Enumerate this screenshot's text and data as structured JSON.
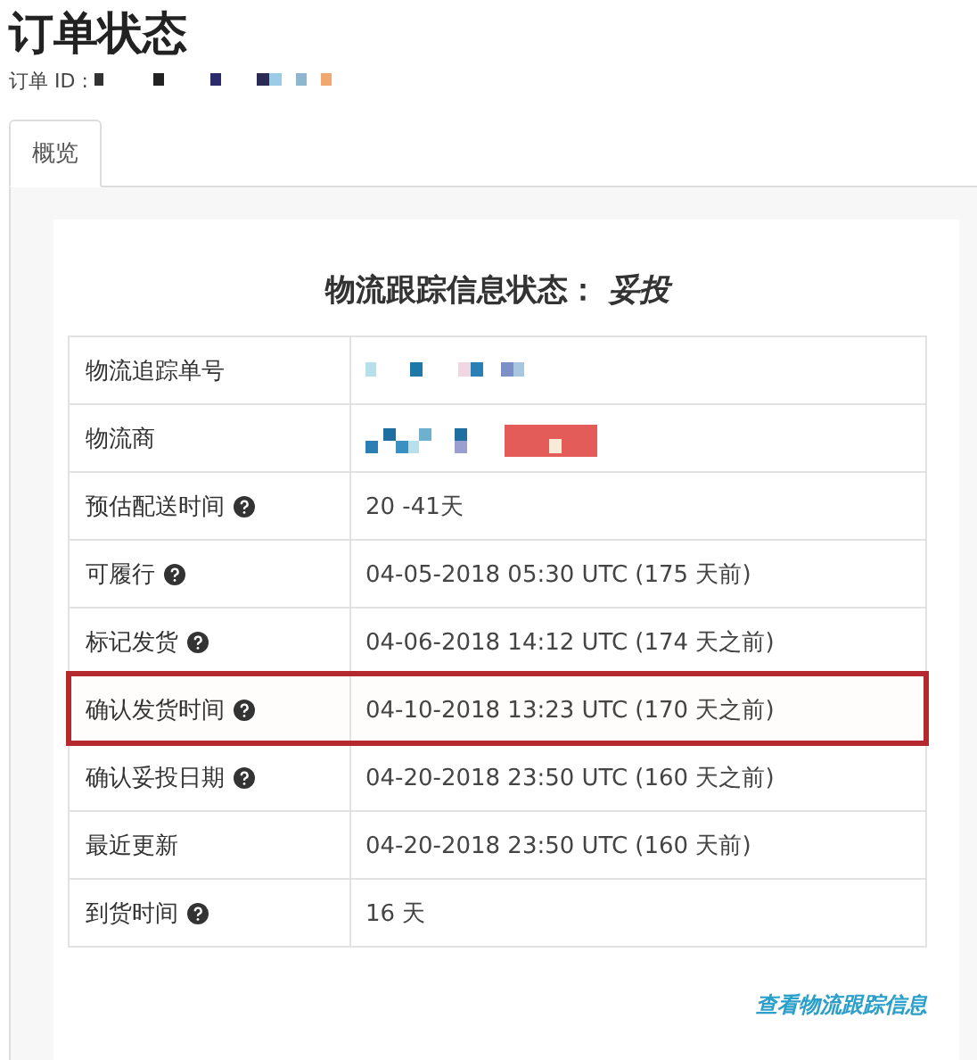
{
  "page_title": "订单状态",
  "order_id": {
    "label": "订单 ID :",
    "value_redacted": true
  },
  "tabs": [
    {
      "label": "概览",
      "selected": true
    }
  ],
  "status_heading": "物流跟踪信息状态： *妥投*",
  "rows": [
    {
      "label": "物流追踪单号",
      "help": false,
      "kind": "redacted",
      "highlighted": false
    },
    {
      "label": "物流商",
      "help": false,
      "kind": "redacted-logo",
      "highlighted": false
    },
    {
      "label": "预估配送时间",
      "help": true,
      "kind": "text",
      "value": "20 -41天",
      "highlighted": false
    },
    {
      "label": "可履行",
      "help": true,
      "kind": "text",
      "value": "04-05-2018 05:30 UTC (175 天前)",
      "highlighted": false
    },
    {
      "label": "标记发货",
      "help": true,
      "kind": "text",
      "value": "04-06-2018 14:12 UTC (174 天之前)",
      "highlighted": false
    },
    {
      "label": "确认发货时间",
      "help": true,
      "kind": "text",
      "value": "04-10-2018 13:23 UTC (170 天之前)",
      "highlighted": true
    },
    {
      "label": "确认妥投日期",
      "help": true,
      "kind": "text",
      "value": "04-20-2018 23:50 UTC (160 天之前)",
      "highlighted": false
    },
    {
      "label": "最近更新",
      "help": false,
      "kind": "text",
      "value": "04-20-2018 23:50 UTC (160 天前)",
      "highlighted": false
    },
    {
      "label": "到货时间",
      "help": true,
      "kind": "text",
      "value": "16 天",
      "highlighted": false
    }
  ],
  "tracking_link": "查看物流跟踪信息"
}
